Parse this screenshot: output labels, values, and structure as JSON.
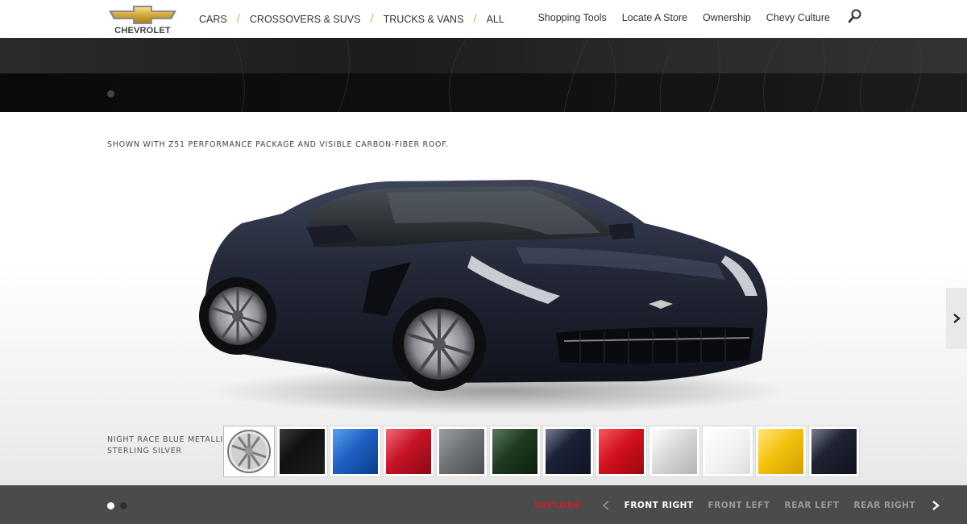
{
  "header": {
    "logo_text": "CHEVROLET",
    "primary_nav": [
      "CARS",
      "CROSSOVERS & SUVS",
      "TRUCKS & VANS",
      "ALL"
    ],
    "separator": "/",
    "secondary_nav": [
      "Shopping Tools",
      "Locate A Store",
      "Ownership",
      "Chevy Culture"
    ],
    "search_icon": "search-icon"
  },
  "vehicle": {
    "caption": "SHOWN WITH Z51 PERFORMANCE PACKAGE AND VISIBLE CARBON-FIBER ROOF.",
    "color_name_line1": "NIGHT RACE BLUE METALLIC",
    "color_name_line2": "STERLING SILVER",
    "swatches": [
      {
        "name": "sterling-silver-wheel",
        "color": "#c8c8c8"
      },
      {
        "name": "black",
        "color": "#1c1c1c"
      },
      {
        "name": "blue",
        "color": "#1f62c4"
      },
      {
        "name": "red",
        "color": "#c81426"
      },
      {
        "name": "gray",
        "color": "#707476"
      },
      {
        "name": "green",
        "color": "#1f3a21"
      },
      {
        "name": "night-race-blue",
        "color": "#1b2236"
      },
      {
        "name": "torch-red",
        "color": "#d3121f"
      },
      {
        "name": "silver",
        "color": "#d9d9d9"
      },
      {
        "name": "white",
        "color": "#f2f3f4"
      },
      {
        "name": "yellow",
        "color": "#f4c20f"
      },
      {
        "name": "dark-blue",
        "color": "#1e2333"
      }
    ]
  },
  "footer": {
    "explore_label": "EXPLORE:",
    "views": [
      "FRONT RIGHT",
      "FRONT LEFT",
      "REAR LEFT",
      "REAR RIGHT"
    ],
    "active_view": "FRONT RIGHT"
  },
  "colors": {
    "accent_gold": "#d1b46c",
    "explore_red": "#c6202a",
    "bottom_bar": "#4b4b4b"
  }
}
